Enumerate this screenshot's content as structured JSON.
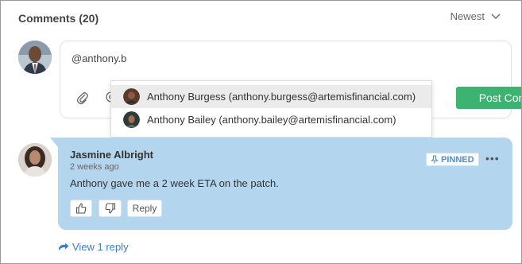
{
  "header": {
    "title": "Comments (20)",
    "sort_label": "Newest"
  },
  "composer": {
    "value": "@anthony.b",
    "post_button_label": "Post Comment"
  },
  "mention_suggestions": [
    {
      "label": "Anthony Burgess (anthony.burgess@artemisfinancial.com)"
    },
    {
      "label": "Anthony Bailey (anthony.bailey@artemisfinancial.com)"
    }
  ],
  "comment": {
    "author": "Jasmine Albright",
    "time": "2 weeks ago",
    "text": "Anthony gave me a 2 week ETA on the patch.",
    "pinned_label": "PINNED",
    "more_label": "•••",
    "reply_label": "Reply"
  },
  "view_reply_label": "View 1 reply",
  "colors": {
    "accent_green": "#3cb371",
    "bubble_blue": "#b3d6ee",
    "link_blue": "#3a7fc1"
  }
}
